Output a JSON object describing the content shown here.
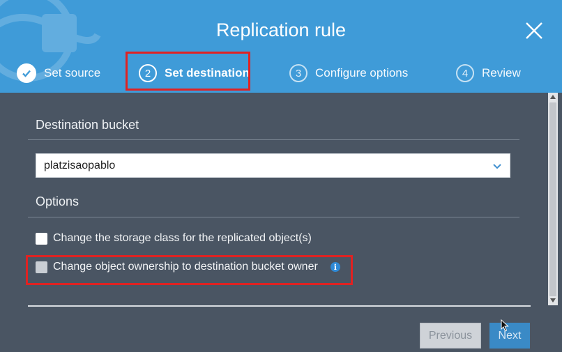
{
  "dialog": {
    "title": "Replication rule",
    "close_icon": "close-icon"
  },
  "steps": [
    {
      "number": "",
      "label": "Set source",
      "state": "completed"
    },
    {
      "number": "2",
      "label": "Set destination",
      "state": "active"
    },
    {
      "number": "3",
      "label": "Configure options",
      "state": "pending"
    },
    {
      "number": "4",
      "label": "Review",
      "state": "pending"
    }
  ],
  "destination": {
    "section_title": "Destination bucket",
    "bucket_value": "platzisaopablo"
  },
  "options": {
    "section_title": "Options",
    "storage_class_label": "Change the storage class for the replicated object(s)",
    "ownership_label": "Change object ownership to destination bucket owner"
  },
  "footer": {
    "previous_label": "Previous",
    "next_label": "Next"
  },
  "colors": {
    "header": "#3f9bd8",
    "body": "#4a5563",
    "highlight": "#e02222",
    "next_button": "#3a8ac6"
  }
}
